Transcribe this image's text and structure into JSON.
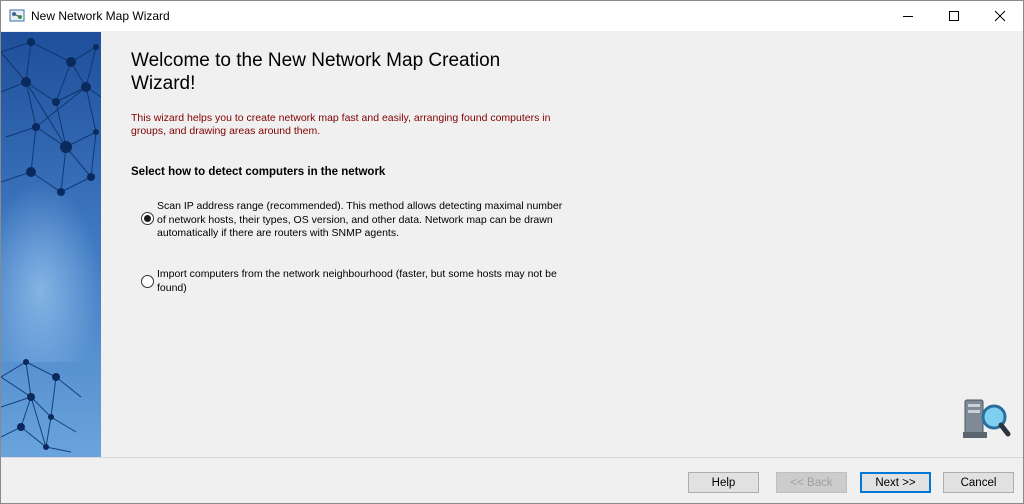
{
  "window": {
    "title": "New Network Map Wizard",
    "app_icon": "network-map-icon",
    "controls": [
      "minimize-icon",
      "maximize-icon",
      "close-icon"
    ]
  },
  "page": {
    "heading": "Welcome to the New Network Map Creation Wizard!",
    "description": "This wizard helps you to create network map fast and easily, arranging found computers in groups, and drawing areas around them.",
    "section_title": "Select how to detect computers in the network",
    "options": [
      {
        "label": "Scan IP address range (recommended). This method allows detecting maximal number of network hosts, their types, OS version, and other data. Network map can be drawn automatically if there are routers with SNMP agents.",
        "selected": true
      },
      {
        "label": "Import computers from the network neighbourhood (faster, but some hosts may not be found)",
        "selected": false
      }
    ],
    "illustration": "computer-magnifier-icon"
  },
  "buttons": {
    "help": "Help",
    "back": "<< Back",
    "next": "Next >>",
    "cancel": "Cancel"
  },
  "colors": {
    "description_text": "#800000",
    "sidebar_gradient_top": "#1f4f9a",
    "sidebar_gradient_bottom": "#5b98d8",
    "default_button_border": "#0078d7"
  }
}
